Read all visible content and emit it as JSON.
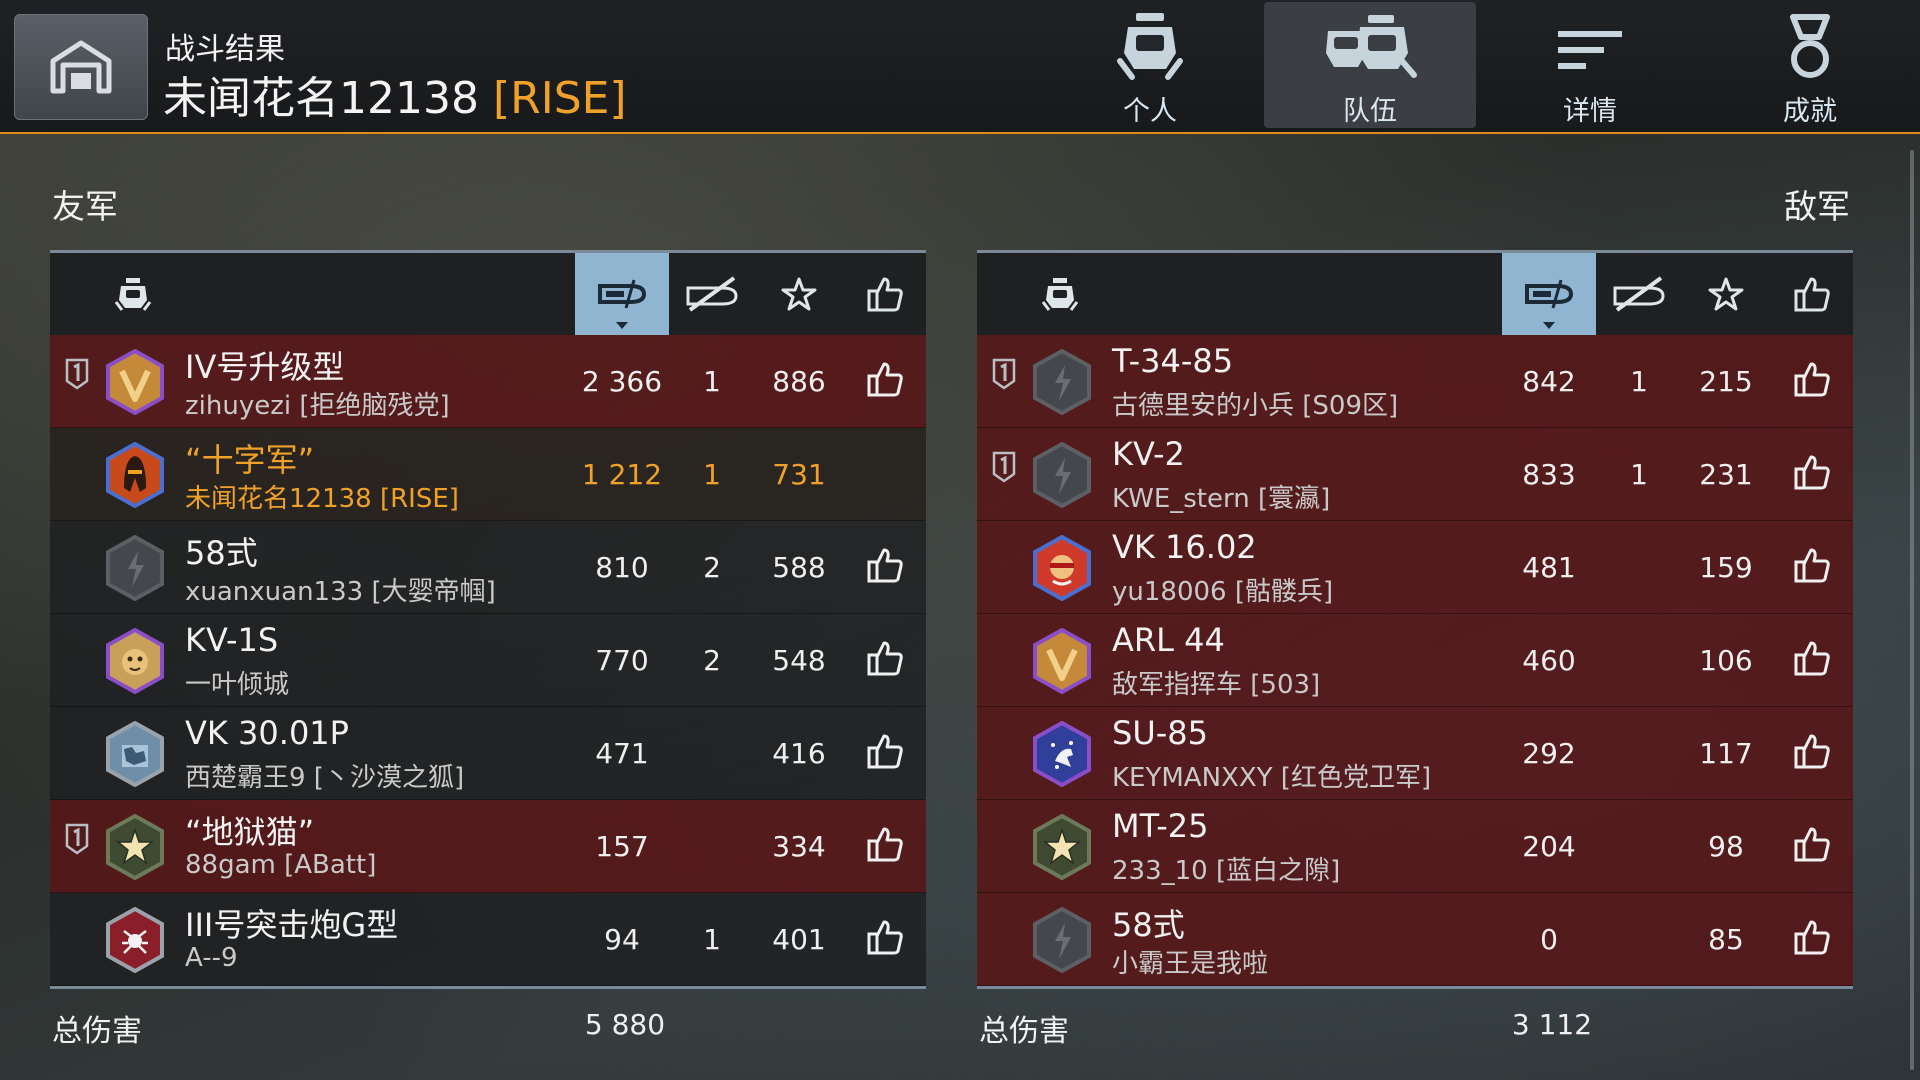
{
  "header": {
    "title": "战斗结果",
    "player_name": "未闻花名12138",
    "player_clan": "[RISE]",
    "tabs": [
      {
        "label": "个人",
        "icon": "single-tank-icon",
        "active": false
      },
      {
        "label": "队伍",
        "icon": "team-tanks-icon",
        "active": true
      },
      {
        "label": "详情",
        "icon": "details-list-icon",
        "active": false
      },
      {
        "label": "成就",
        "icon": "medal-icon",
        "active": false
      }
    ]
  },
  "allies": {
    "title": "友军",
    "total_label": "总伤害",
    "total_value": "5 880",
    "rows": [
      {
        "platoon": true,
        "icon": "v-emblem-purple",
        "vehicle": "IV号升级型",
        "player": "zihuyezi [拒绝脑残党]",
        "damage": "2 366",
        "kills": "1",
        "exp": "886",
        "like": true,
        "style": "red"
      },
      {
        "platoon": false,
        "icon": "crusader-helmet-blue",
        "vehicle": "“十字军”",
        "player": "未闻花名12138 [RISE]",
        "damage": "1 212",
        "kills": "1",
        "exp": "731",
        "like": false,
        "style": "self"
      },
      {
        "platoon": false,
        "icon": "grey-default",
        "vehicle": "58式",
        "player": "xuanxuan133 [大婴帝帼]",
        "damage": "810",
        "kills": "2",
        "exp": "588",
        "like": true,
        "style": "dark"
      },
      {
        "platoon": false,
        "icon": "tiger-emblem-purple",
        "vehicle": "KV-1S",
        "player": "一叶倾城",
        "damage": "770",
        "kills": "2",
        "exp": "548",
        "like": true,
        "style": "dark"
      },
      {
        "platoon": false,
        "icon": "camo-emblem-grey",
        "vehicle": "VK 30.01P",
        "player": "西楚霸王9 [丶沙漠之狐]",
        "damage": "471",
        "kills": "",
        "exp": "416",
        "like": true,
        "style": "dark"
      },
      {
        "platoon": true,
        "icon": "star-emblem-green",
        "vehicle": "“地狱猫”",
        "player": "88gam [ABatt]",
        "damage": "157",
        "kills": "",
        "exp": "334",
        "like": true,
        "style": "red"
      },
      {
        "platoon": false,
        "icon": "spider-emblem-red",
        "vehicle": "III号突击炮G型",
        "player": "A--9",
        "damage": "94",
        "kills": "1",
        "exp": "401",
        "like": true,
        "style": "dark"
      }
    ]
  },
  "enemies": {
    "title": "敌军",
    "total_label": "总伤害",
    "total_value": "3 112",
    "rows": [
      {
        "platoon": true,
        "icon": "grey-default",
        "vehicle": "T-34-85",
        "player": "古德里安的小兵 [S09区]",
        "damage": "842",
        "kills": "1",
        "exp": "215",
        "like": true,
        "style": "red"
      },
      {
        "platoon": true,
        "icon": "grey-default",
        "vehicle": "KV-2",
        "player": "KWE_stern [寰瀛]",
        "damage": "833",
        "kills": "1",
        "exp": "231",
        "like": true,
        "style": "red"
      },
      {
        "platoon": false,
        "icon": "hero-emblem-blue",
        "vehicle": "VK 16.02",
        "player": "yu18006 [骷髅兵]",
        "damage": "481",
        "kills": "",
        "exp": "159",
        "like": true,
        "style": "red"
      },
      {
        "platoon": false,
        "icon": "v-emblem-purple",
        "vehicle": "ARL 44",
        "player": "敌军指挥车 [503]",
        "damage": "460",
        "kills": "",
        "exp": "106",
        "like": true,
        "style": "red"
      },
      {
        "platoon": false,
        "icon": "kangaroo-emblem-purple",
        "vehicle": "SU-85",
        "player": "KEYMANXXY [红色党卫军]",
        "damage": "292",
        "kills": "",
        "exp": "117",
        "like": true,
        "style": "red"
      },
      {
        "platoon": false,
        "icon": "star-emblem-green",
        "vehicle": "MT-25",
        "player": "233_10 [蓝白之隙]",
        "damage": "204",
        "kills": "",
        "exp": "98",
        "like": true,
        "style": "red"
      },
      {
        "platoon": false,
        "icon": "grey-default",
        "vehicle": "58式",
        "player": "小霸王是我啦",
        "damage": "0",
        "kills": "",
        "exp": "85",
        "like": true,
        "style": "red"
      }
    ]
  },
  "colors": {
    "accent": "#e08a1c",
    "self_highlight": "#f0a12a",
    "sorted_column": "#8fb5d0",
    "row_red": "#581618"
  }
}
